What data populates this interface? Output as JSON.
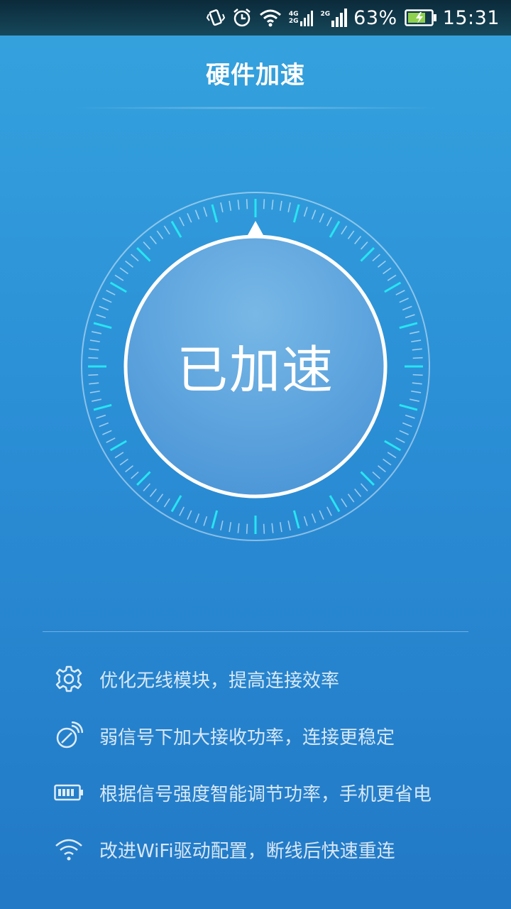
{
  "status_bar": {
    "icons": [
      "vibrate-icon",
      "alarm-icon",
      "wifi-icon",
      "signal-4g-2g-icon",
      "signal-2g-icon",
      "battery-charging-icon"
    ],
    "net_primary": "4G",
    "net_secondary": "2G",
    "net_sim2": "2G",
    "battery": "63%",
    "time": "15:31"
  },
  "header": {
    "title": "硬件加速"
  },
  "dial": {
    "label": "已加速"
  },
  "features": [
    {
      "icon": "gear-icon",
      "text": "优化无线模块，提高连接效率"
    },
    {
      "icon": "signal-boost-icon",
      "text": "弱信号下加大接收功率，连接更稳定"
    },
    {
      "icon": "battery-icon",
      "text": "根据信号强度智能调节功率，手机更省电"
    },
    {
      "icon": "wifi-icon",
      "text": "改进WiFi驱动配置，断线后快速重连"
    }
  ],
  "colors": {
    "accent_tick": "#27e5f2",
    "bg_top": "#35a3de",
    "bg_bottom": "#2279c6"
  }
}
